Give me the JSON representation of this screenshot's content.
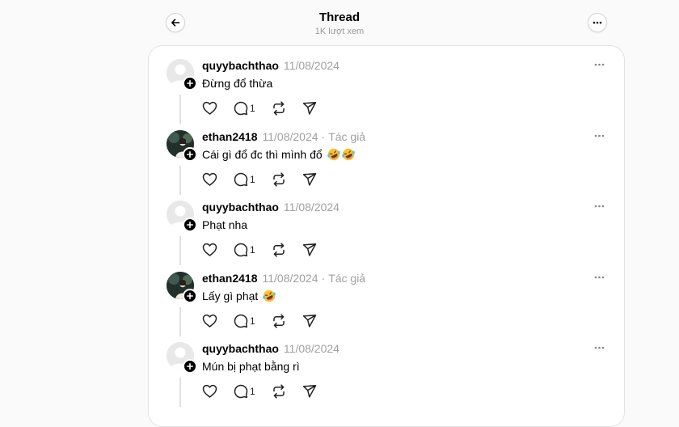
{
  "header": {
    "title": "Thread",
    "views": "1K lượt xem"
  },
  "posts": [
    {
      "username": "quyybachthao",
      "date": "11/08/2024",
      "author_tag": "",
      "text": "Đừng đổ thừa",
      "emojis": [],
      "reply_count": "1",
      "avatar": "default-avatar"
    },
    {
      "username": "ethan2418",
      "date": "11/08/2024",
      "author_tag": "Tác giả",
      "text": "Cái gì đổ đc thì mình đổ",
      "emojis": [
        "rolling-laughing-emoji",
        "rolling-laughing-emoji"
      ],
      "reply_count": "1",
      "avatar": "photo-avatar"
    },
    {
      "username": "quyybachthao",
      "date": "11/08/2024",
      "author_tag": "",
      "text": "Phạt nha",
      "emojis": [],
      "reply_count": "1",
      "avatar": "default-avatar"
    },
    {
      "username": "ethan2418",
      "date": "11/08/2024",
      "author_tag": "Tác giả",
      "text": "Lấy gì phạt",
      "emojis": [
        "rolling-laughing-emoji"
      ],
      "reply_count": "1",
      "avatar": "photo-avatar"
    },
    {
      "username": "quyybachthao",
      "date": "11/08/2024",
      "author_tag": "",
      "text": "Mún bị phạt bằng rì",
      "emojis": [],
      "reply_count": "1",
      "avatar": "default-avatar"
    }
  ],
  "icons": {
    "back": "arrow-left-icon",
    "more": "more-horizontal-icon",
    "like": "heart-icon",
    "reply": "comment-icon",
    "repost": "repost-icon",
    "share": "send-icon",
    "follow": "plus-icon"
  },
  "colors": {
    "background": "#fafafa",
    "card": "#ffffff",
    "muted_text": "#a0a0a0",
    "border": "#e3e3e3"
  }
}
